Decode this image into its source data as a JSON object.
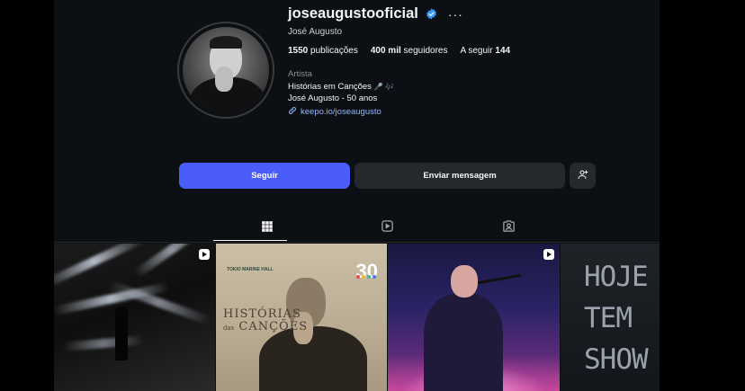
{
  "profile": {
    "username": "joseaugustooficial",
    "verified": true,
    "more_icon": "more-horizontal-icon",
    "full_name": "José Augusto",
    "stats": {
      "posts_count": "1550",
      "posts_label": "publicações",
      "followers_count": "400 mil",
      "followers_label": "seguidores",
      "following_label": "A seguir",
      "following_count": "144"
    },
    "category": "Artista",
    "bio_line1": "Histórias em Canções",
    "bio_line1_emojis": "🎤 🎶",
    "bio_line2": "José Augusto - 50 anos",
    "link": "keepo.io/joseaugusto"
  },
  "actions": {
    "follow_label": "Seguir",
    "message_label": "Enviar mensagem",
    "suggest_icon": "add-person-icon"
  },
  "tabs": [
    {
      "name": "posts",
      "icon": "grid-icon",
      "active": true
    },
    {
      "name": "reels",
      "icon": "reels-icon",
      "active": false
    },
    {
      "name": "tagged",
      "icon": "tagged-icon",
      "active": false
    }
  ],
  "posts": [
    {
      "type": "reel",
      "description_icon": "reel-icon"
    },
    {
      "type": "image",
      "title": "HISTÓRIAS",
      "subtitle": "das",
      "title2": "CANÇÕES",
      "badge": "30",
      "logo": "TOKIO MARINE HALL"
    },
    {
      "type": "reel",
      "description_icon": "reel-icon"
    },
    {
      "type": "image",
      "text_lines": [
        "HOJE",
        "TEM",
        "SHOW"
      ]
    }
  ],
  "colors": {
    "background": "#0c1014",
    "follow_button": "#4a5df9",
    "secondary_button": "#25292e",
    "verified_badge": "#3897f0",
    "link": "#8fb8ff"
  }
}
